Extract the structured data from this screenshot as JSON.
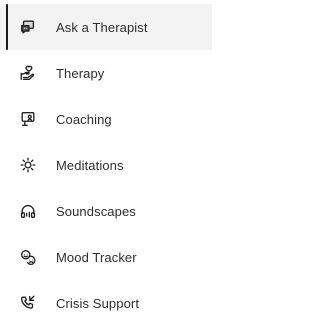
{
  "sidebar": {
    "items": [
      {
        "label": "Ask a Therapist",
        "icon": "chat-bubble-icon",
        "active": true
      },
      {
        "label": "Therapy",
        "icon": "hand-heart-icon",
        "active": false
      },
      {
        "label": "Coaching",
        "icon": "presentation-board-icon",
        "active": false
      },
      {
        "label": "Meditations",
        "icon": "sun-burst-icon",
        "active": false
      },
      {
        "label": "Soundscapes",
        "icon": "headphones-icon",
        "active": false
      },
      {
        "label": "Mood Tracker",
        "icon": "mood-faces-icon",
        "active": false
      },
      {
        "label": "Crisis Support",
        "icon": "phone-call-icon",
        "active": false
      }
    ]
  },
  "colors": {
    "active_background": "#f3f3f3",
    "active_indicator": "#1b1b1b",
    "text": "#2e2e2e",
    "icon": "#222222"
  }
}
